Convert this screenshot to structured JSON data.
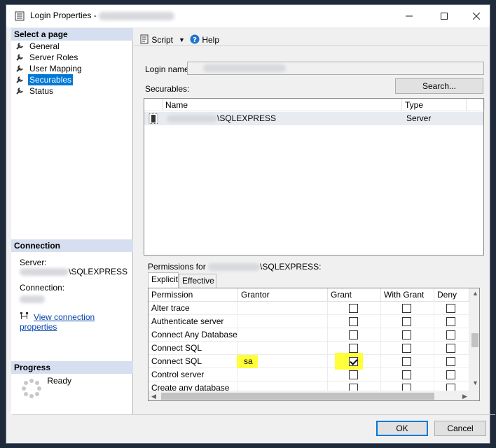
{
  "window": {
    "title": "Login Properties -"
  },
  "sidebar": {
    "select_page_header": "Select a page",
    "items": [
      {
        "label": "General"
      },
      {
        "label": "Server Roles"
      },
      {
        "label": "User Mapping"
      },
      {
        "label": "Securables",
        "selected": true
      },
      {
        "label": "Status"
      }
    ],
    "connection_header": "Connection",
    "server_label": "Server:",
    "server_value": "\\SQLEXPRESS",
    "connection_label": "Connection:",
    "view_connection_link": "View connection properties",
    "progress_header": "Progress",
    "progress_status": "Ready"
  },
  "toolbar": {
    "script_label": "Script",
    "help_label": "Help"
  },
  "main": {
    "login_name_label": "Login name:",
    "securables_label": "Securables:",
    "search_button": "Search...",
    "securables_columns": [
      "Name",
      "Type"
    ],
    "securables_rows": [
      {
        "name": "\\SQLEXPRESS",
        "type": "Server"
      }
    ],
    "permissions_label_prefix": "Permissions for",
    "permissions_label_suffix": "\\SQLEXPRESS:",
    "tabs": [
      {
        "label": "Explicit",
        "active": true
      },
      {
        "label": "Effective",
        "active": false
      }
    ],
    "perm_columns": [
      "Permission",
      "Grantor",
      "Grant",
      "With Grant",
      "Deny"
    ],
    "perm_rows": [
      {
        "permission": "Alter trace",
        "grantor": "",
        "grant": false,
        "with_grant": false,
        "deny": false
      },
      {
        "permission": "Authenticate server",
        "grantor": "",
        "grant": false,
        "with_grant": false,
        "deny": false
      },
      {
        "permission": "Connect Any Database",
        "grantor": "",
        "grant": false,
        "with_grant": false,
        "deny": false
      },
      {
        "permission": "Connect SQL",
        "grantor": "",
        "grant": false,
        "with_grant": false,
        "deny": false
      },
      {
        "permission": "Connect SQL",
        "grantor": "sa",
        "grant": true,
        "with_grant": false,
        "deny": false
      },
      {
        "permission": "Control server",
        "grantor": "",
        "grant": false,
        "with_grant": false,
        "deny": false
      },
      {
        "permission": "Create any database",
        "grantor": "",
        "grant": false,
        "with_grant": false,
        "deny": false
      }
    ],
    "highlight_color": "#ffff3a"
  },
  "footer": {
    "ok_button": "OK",
    "cancel_button": "Cancel"
  }
}
